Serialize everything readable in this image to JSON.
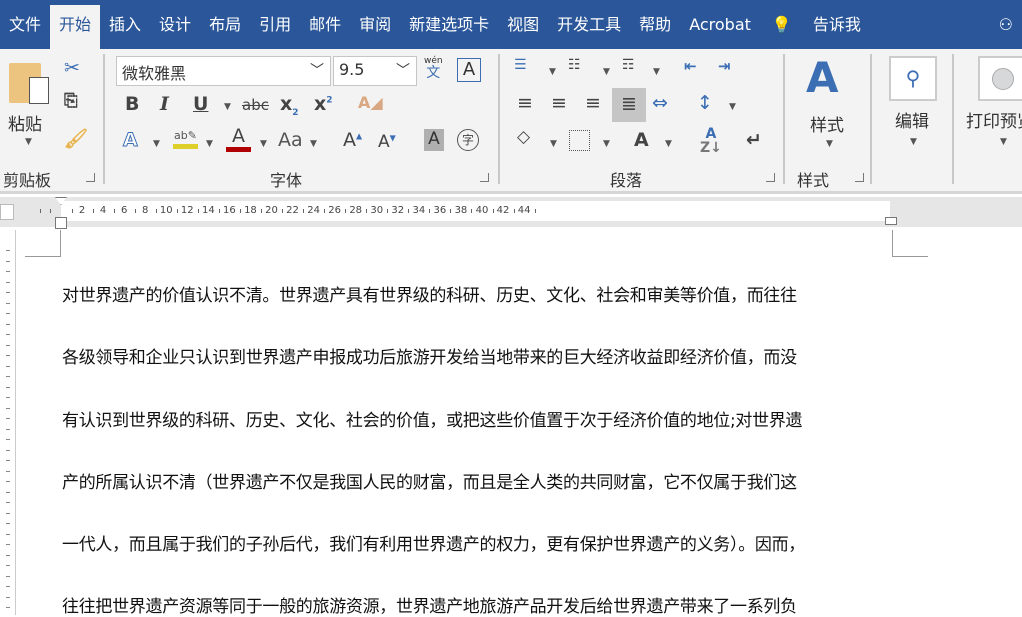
{
  "tabs": [
    "文件",
    "开始",
    "插入",
    "设计",
    "布局",
    "引用",
    "邮件",
    "审阅",
    "新建选项卡",
    "视图",
    "开发工具",
    "帮助",
    "Acrobat"
  ],
  "tell_me": "告诉我",
  "ribbon": {
    "clipboard": {
      "paste": "粘贴",
      "label": "剪贴板"
    },
    "font": {
      "name": "微软雅黑",
      "size": "9.5",
      "label": "字体",
      "wen": "wén",
      "wen_char": "文"
    },
    "paragraph": {
      "label": "段落"
    },
    "styles": {
      "button": "样式",
      "label": "样式"
    },
    "editing": {
      "button": "编辑"
    },
    "print_preview": {
      "button": "打印预览"
    }
  },
  "ruler": {
    "numbers": [
      "2",
      "4",
      "6",
      "8",
      "10",
      "12",
      "14",
      "16",
      "18",
      "20",
      "22",
      "24",
      "26",
      "28",
      "30",
      "32",
      "34",
      "36",
      "38",
      "40",
      "42",
      "44"
    ]
  },
  "document": {
    "lines": [
      "对世界遗产的价值认识不清。世界遗产具有世界级的科研、历史、文化、社会和审美等价值，而往往",
      "各级领导和企业只认识到世界遗产申报成功后旅游开发给当地带来的巨大经济收益即经济价值，而没",
      "有认识到世界级的科研、历史、文化、社会的价值，或把这些价值置于次于经济价值的地位;对世界遗",
      "产的所属认识不清（世界遗产不仅是我国人民的财富，而且是全人类的共同财富，它不仅属于我们这",
      "一代人，而且属于我们的子孙后代，我们有利用世界遗产的权力，更有保护世界遗产的义务）。因而，",
      "往往把世界遗产资源等同于一般的旅游资源，世界遗产地旅游产品开发后给世界遗产带来了一系列负"
    ]
  }
}
